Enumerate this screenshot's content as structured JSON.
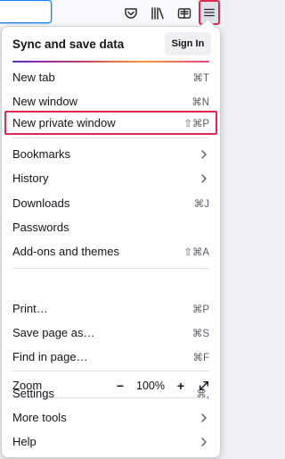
{
  "toolbar": {
    "icons": [
      "pocket-icon",
      "library-icon",
      "reader-view-icon",
      "hamburger-menu-icon"
    ]
  },
  "menu": {
    "sync": {
      "title": "Sync and save data",
      "signin_label": "Sign In"
    },
    "items": {
      "new_tab": {
        "label": "New tab",
        "shortcut": "⌘T"
      },
      "new_window": {
        "label": "New window",
        "shortcut": "⌘N"
      },
      "new_private_window": {
        "label": "New private window",
        "shortcut": "⇧⌘P"
      },
      "bookmarks": {
        "label": "Bookmarks"
      },
      "history": {
        "label": "History"
      },
      "downloads": {
        "label": "Downloads",
        "shortcut": "⌘J"
      },
      "passwords": {
        "label": "Passwords"
      },
      "addons": {
        "label": "Add-ons and themes",
        "shortcut": "⇧⌘A"
      },
      "print": {
        "label": "Print…",
        "shortcut": "⌘P"
      },
      "save_page": {
        "label": "Save page as…",
        "shortcut": "⌘S"
      },
      "find": {
        "label": "Find in page…",
        "shortcut": "⌘F"
      },
      "zoom": {
        "label": "Zoom",
        "minus": "−",
        "value": "100%",
        "plus": "+"
      },
      "settings": {
        "label": "Settings",
        "shortcut": "⌘,"
      },
      "more_tools": {
        "label": "More tools"
      },
      "help": {
        "label": "Help"
      }
    }
  },
  "colors": {
    "highlight": "#e22850",
    "accent": "#0a84ff"
  }
}
